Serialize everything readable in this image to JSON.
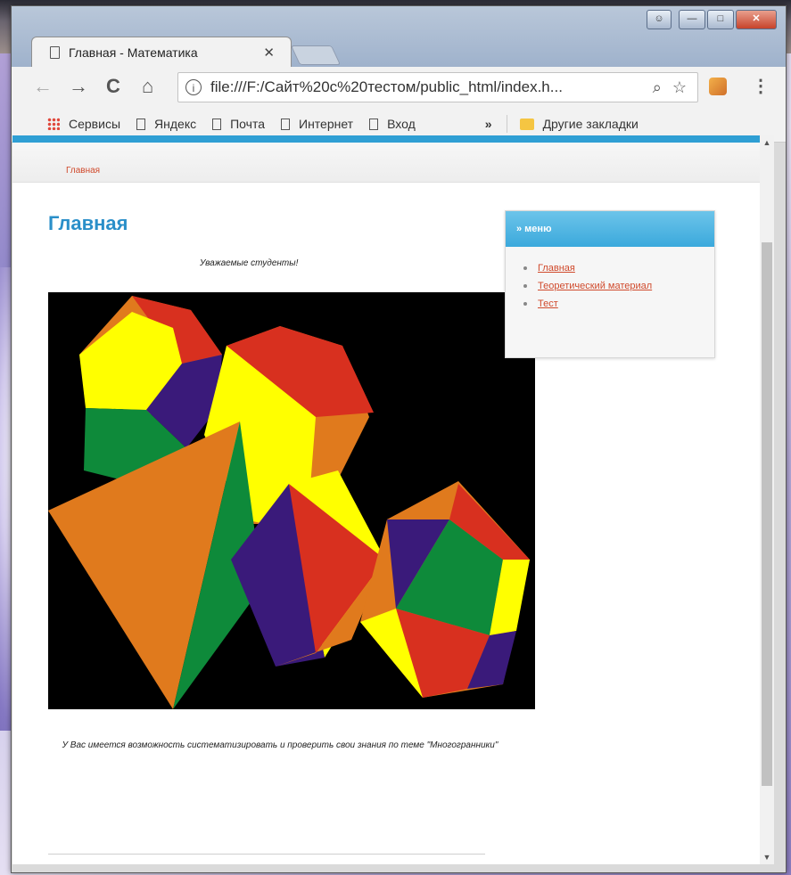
{
  "browser": {
    "tab_title": "Главная - Математика",
    "tab_close": "✕",
    "url": "file:///F:/Сайт%20с%20тестом/public_html/index.h...",
    "nav": {
      "back": "←",
      "forward": "→",
      "reload": "C",
      "home": "⌂"
    },
    "zoom": "⌕",
    "star": "☆",
    "menu": "⋮",
    "window_controls": {
      "user": "☺",
      "minimize": "—",
      "maximize": "□",
      "close": "✕"
    }
  },
  "bookmarks": {
    "items": [
      "Сервисы",
      "Яндекс",
      "Почта",
      "Интернет",
      "Вход"
    ],
    "overflow": "»",
    "other": "Другие закладки"
  },
  "page": {
    "breadcrumb": "Главная",
    "title": "Главная",
    "greeting": "Уважаемые студенты!",
    "bottom_text": "У Вас имеется возможность систематизировать и проверить свои знания по теме \"Многогранники\""
  },
  "sidebar": {
    "heading": "» меню",
    "links": [
      "Главная",
      "Теоретический материал",
      "Тест"
    ]
  },
  "icons": {
    "apps": "apps-grid-icon",
    "page": "page-icon",
    "info": "info-icon",
    "folder": "folder-icon"
  },
  "colors": {
    "accent": "#2f9fd4",
    "link": "#d04a2c",
    "title": "#2a8fc9",
    "sidebar_header": "#3ba9dc"
  }
}
